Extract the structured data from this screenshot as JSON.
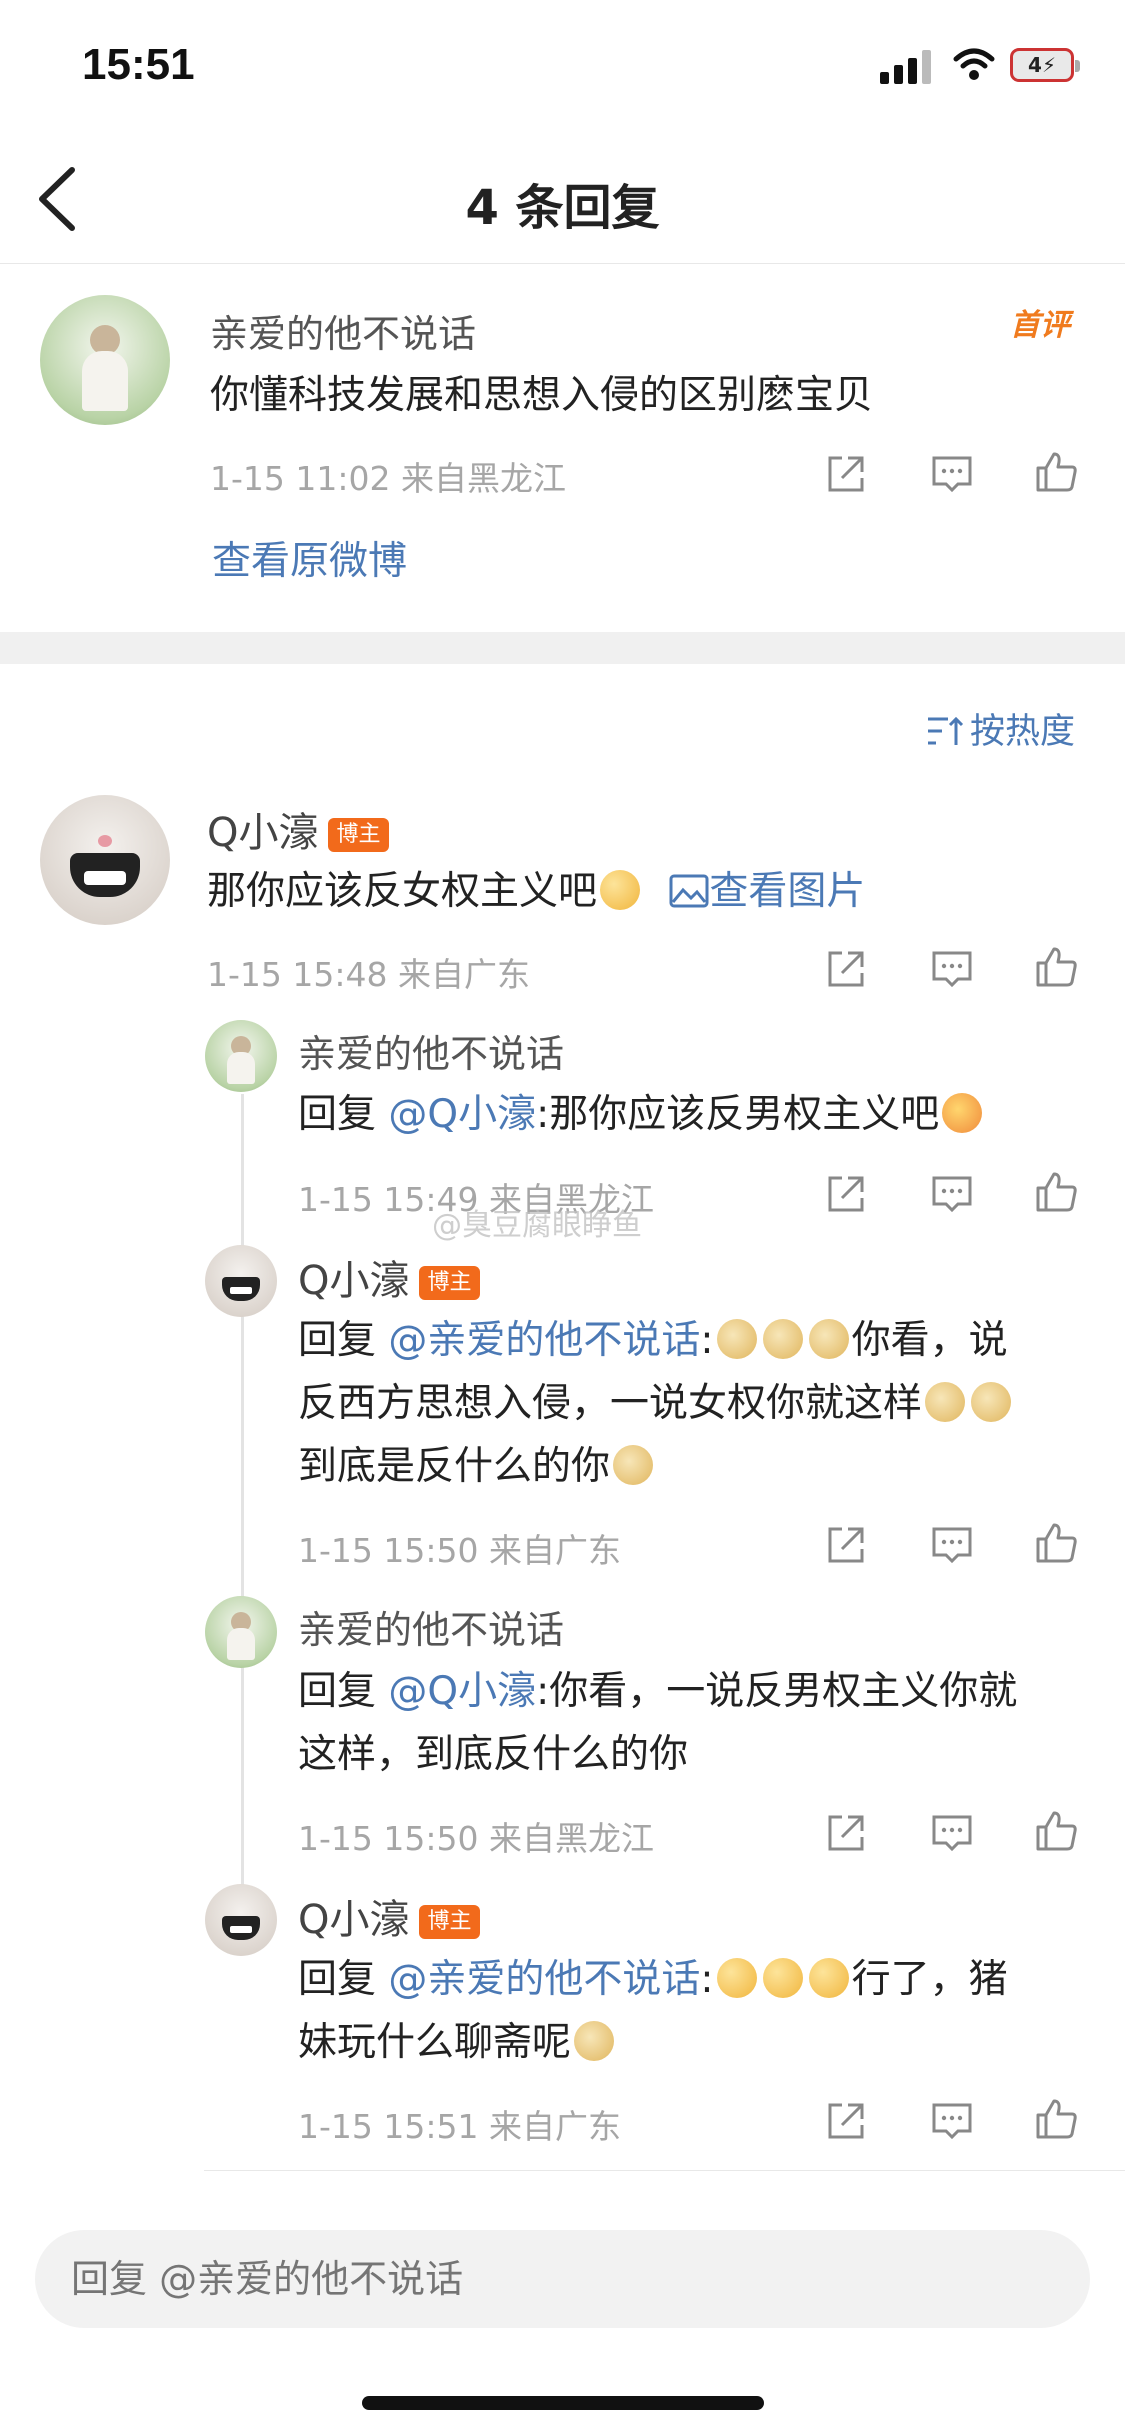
{
  "status_bar": {
    "time": "15:51",
    "battery": "4"
  },
  "nav": {
    "title": "4 条回复"
  },
  "root_comment": {
    "name": "亲爱的他不说话",
    "text": "你懂科技发展和思想入侵的区别麽宝贝",
    "meta": "1-15 11:02  来自黑龙江",
    "tag": "首评",
    "view_original": "查看原微博"
  },
  "sort": {
    "label": "按热度"
  },
  "main_comment": {
    "name": "Q小濠",
    "badge": "博主",
    "text": "那你应该反女权主义吧",
    "view_image": "查看图片",
    "meta": "1-15 15:48  来自广东"
  },
  "replies": [
    {
      "name": "亲爱的他不说话",
      "prefix": "回复 ",
      "mention": "@Q小濠",
      "text": ":那你应该反男权主义吧",
      "meta": "1-15 15:49  来自黑龙江"
    },
    {
      "name": "Q小濠",
      "badge": "博主",
      "prefix": "回复 ",
      "mention": "@亲爱的他不说话",
      "text_a": "你看，说",
      "text_b": "反西方思想入侵，一说女权你就这样",
      "text_c": "到底是反什么的你",
      "meta": "1-15 15:50  来自广东"
    },
    {
      "name": "亲爱的他不说话",
      "prefix": "回复 ",
      "mention": "@Q小濠",
      "text_a": ":你看，一说反男权主义你就",
      "text_b": "这样，到底反什么的你",
      "meta": "1-15 15:50  来自黑龙江"
    },
    {
      "name": "Q小濠",
      "badge": "博主",
      "prefix": "回复 ",
      "mention": "@亲爱的他不说话",
      "text_a": "行了，猪",
      "text_b": "妹玩什么聊斋呢",
      "meta": "1-15 15:51  来自广东"
    }
  ],
  "watermark": "@臭豆腐眼睁鱼",
  "reply_input": {
    "placeholder": "回复 @亲爱的他不说话"
  },
  "colors": {
    "link": "#4b79b5",
    "badge": "#f26a1b",
    "tag": "#f07b1e"
  },
  "icons": [
    "back-icon",
    "share-icon",
    "comment-icon",
    "like-icon",
    "image-icon",
    "sort-icon"
  ]
}
